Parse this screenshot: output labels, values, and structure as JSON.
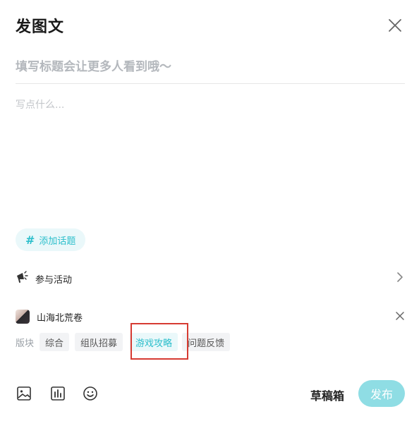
{
  "dialog": {
    "title": "发图文"
  },
  "editor": {
    "title_placeholder": "填写标题会让更多人看到哦～",
    "body_placeholder": "写点什么..."
  },
  "topic": {
    "label": "添加话题"
  },
  "activity": {
    "label": "参与活动"
  },
  "game": {
    "name": "山海北荒卷"
  },
  "section": {
    "label": "版块",
    "options": [
      "综合",
      "组队招募",
      "游戏攻略",
      "问题反馈"
    ],
    "selected": "游戏攻略"
  },
  "footer": {
    "draft_label": "草稿箱",
    "publish_label": "发布"
  },
  "colors": {
    "accent": "#2bbecb",
    "publish_disabled": "#8fdde4",
    "highlight_border": "#d63b32"
  },
  "icons": {
    "close": "close-icon",
    "activity": "megaphone-icon",
    "chevron": "chevron-right-icon",
    "image": "image-icon",
    "chart": "chart-icon",
    "emoji": "emoji-icon"
  }
}
